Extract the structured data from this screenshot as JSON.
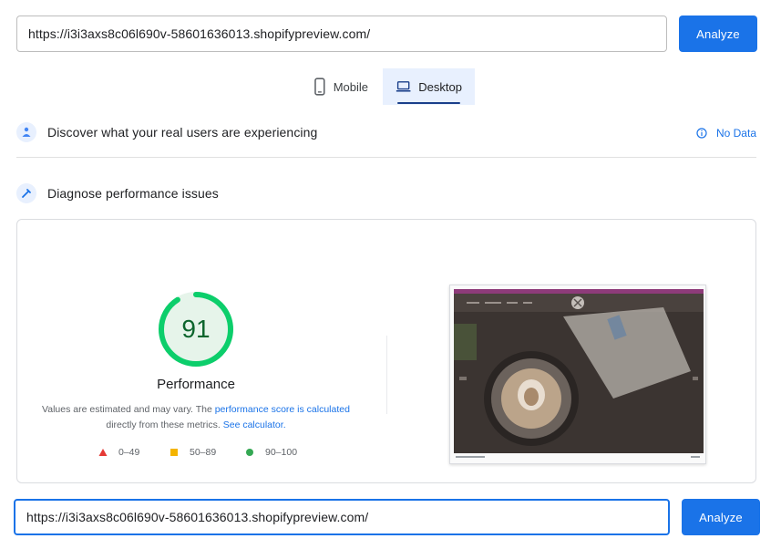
{
  "top_search": {
    "url_value": "https://i3i3axs8c06l690v-58601636013.shopifypreview.com/",
    "analyze_label": "Analyze"
  },
  "device_tabs": [
    {
      "label": "Mobile",
      "icon": "phone-icon",
      "active": false
    },
    {
      "label": "Desktop",
      "icon": "laptop-icon",
      "active": true
    }
  ],
  "field_data": {
    "title": "Discover what your real users are experiencing",
    "status_label": "No Data",
    "status_icon": "info-icon"
  },
  "lab_data": {
    "title": "Diagnose performance issues"
  },
  "performance": {
    "score": "91",
    "score_fraction": 0.91,
    "label": "Performance",
    "note_prefix": "Values are estimated and may vary. The ",
    "note_link1": "performance score is calculated",
    "note_mid": "directly from these metrics. ",
    "note_link2": "See calculator.",
    "legend": [
      {
        "label": "0–49",
        "color": "#e53935",
        "shape": "triangle"
      },
      {
        "label": "50–89",
        "color": "#f4b400",
        "shape": "square"
      },
      {
        "label": "90–100",
        "color": "#34a853",
        "shape": "circle"
      }
    ]
  },
  "bottom_search": {
    "url_value": "https://i3i3axs8c06l690v-58601636013.shopifypreview.com/",
    "analyze_label": "Analyze"
  },
  "colors": {
    "accent": "#1a73e8",
    "good": "#0cce6b",
    "tab_active_bg": "#e8f0fe"
  }
}
